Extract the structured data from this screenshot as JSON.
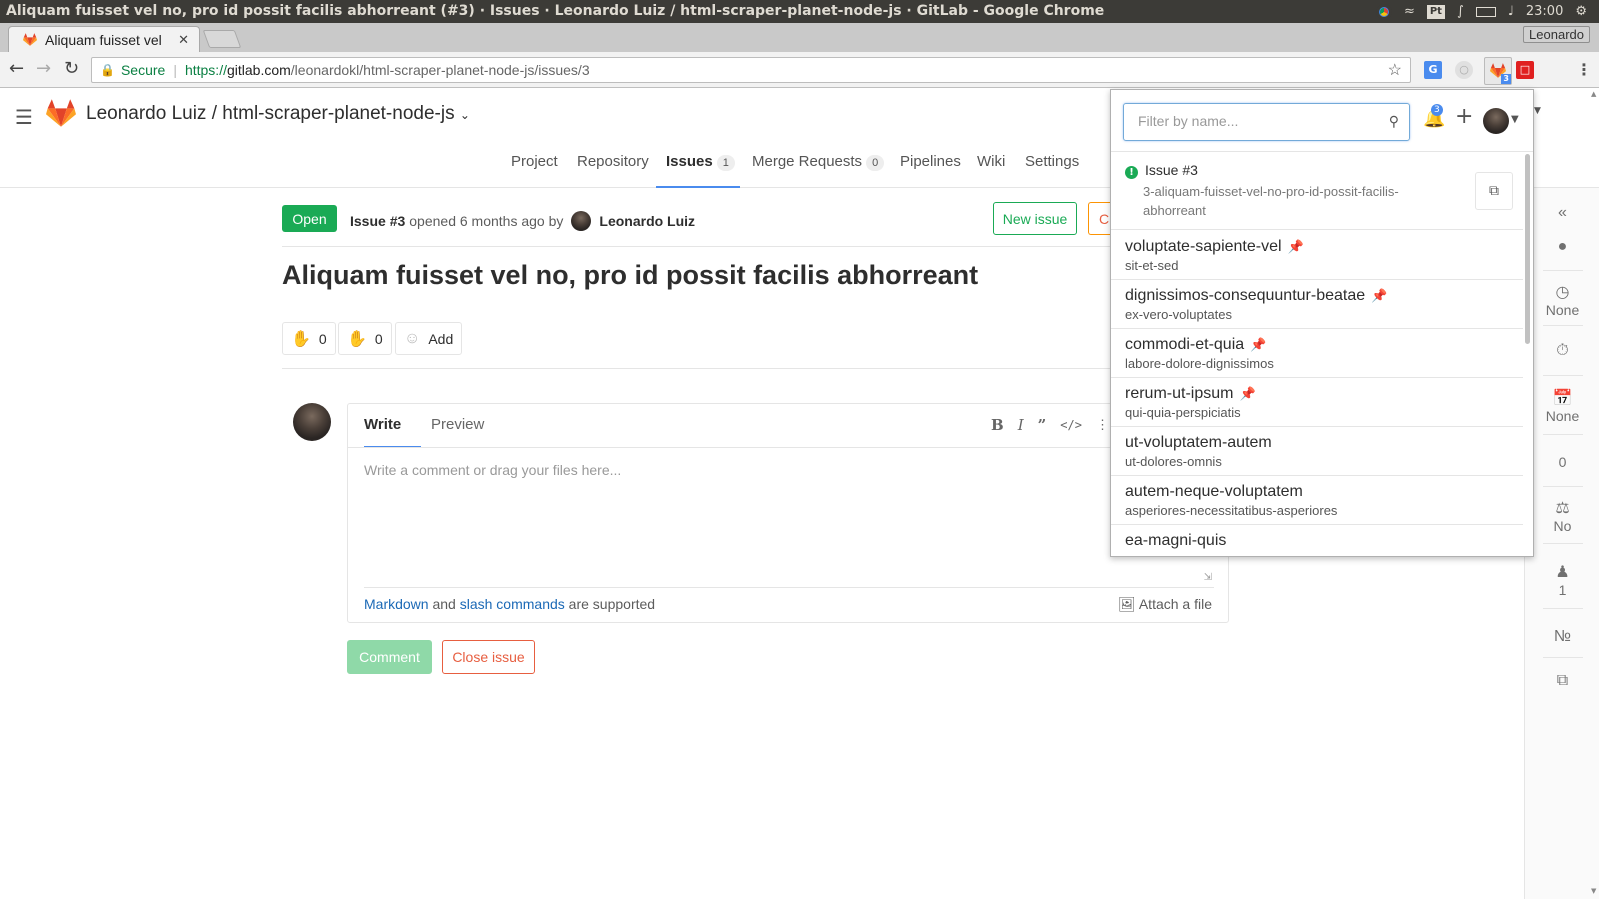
{
  "os": {
    "window_title": "Aliquam fuisset vel no, pro id possit facilis abhorreant (#3) · Issues · Leonardo Luiz / html-scraper-planet-node-js · GitLab - Google Chrome",
    "tray_pt": "Pt",
    "time": "23:00"
  },
  "browser": {
    "tab_title": "Aliquam fuisset vel",
    "profile": "Leonardo",
    "secure_label": "Secure",
    "url_scheme": "https://",
    "url_host": "gitlab.com",
    "url_path": "/leonardokl/html-scraper-planet-node-js/issues/3",
    "ext_badge": "3"
  },
  "header": {
    "project_title": "Leonardo Luiz / html-scraper-planet-node-js",
    "nav": [
      {
        "label": "Project",
        "count": ""
      },
      {
        "label": "Repository",
        "count": ""
      },
      {
        "label": "Issues",
        "count": "1"
      },
      {
        "label": "Merge Requests",
        "count": "0"
      },
      {
        "label": "Pipelines",
        "count": ""
      },
      {
        "label": "Wiki",
        "count": ""
      },
      {
        "label": "Settings",
        "count": ""
      }
    ],
    "active_nav": "Issues"
  },
  "issue": {
    "status": "Open",
    "number": "Issue #3",
    "opened_text": "opened 6 months ago by",
    "author": "Leonardo Luiz",
    "new_issue_label": "New issue",
    "close_partial": "C",
    "title": "Aliquam fuisset vel no, pro id possit facilis abhorreant",
    "thumbs_up": "0",
    "thumbs_down": "0",
    "add_award": "Add"
  },
  "editor": {
    "tab_write": "Write",
    "tab_preview": "Preview",
    "placeholder": "Write a comment or drag your files here...",
    "markdown_link": "Markdown",
    "and_text": "and",
    "slash_link": "slash commands",
    "supported_text": "are supported",
    "attach_label": "Attach a file",
    "comment_button": "Comment",
    "close_button": "Close issue"
  },
  "sidebar": {
    "due_value": "None",
    "milestone_value": "None",
    "time_value": "0",
    "lock_value": "No",
    "participants": "1"
  },
  "popup": {
    "filter_placeholder": "Filter by name...",
    "bell_count": "3",
    "issue_card": {
      "title": "Issue #3",
      "slug": "3-aliquam-fuisset-vel-no-pro-id-possit-facilis-abhorreant"
    },
    "projects": [
      {
        "name": "voluptate-sapiente-vel",
        "namespace": "sit-et-sed",
        "pinned": true
      },
      {
        "name": "dignissimos-consequuntur-beatae",
        "namespace": "ex-vero-voluptates",
        "pinned": true
      },
      {
        "name": "commodi-et-quia",
        "namespace": "labore-dolore-dignissimos",
        "pinned": true
      },
      {
        "name": "rerum-ut-ipsum",
        "namespace": "qui-quia-perspiciatis",
        "pinned": true
      },
      {
        "name": "ut-voluptatem-autem",
        "namespace": "ut-dolores-omnis",
        "pinned": false
      },
      {
        "name": "autem-neque-voluptatem",
        "namespace": "asperiores-necessitatibus-asperiores",
        "pinned": false
      },
      {
        "name": "ea-magni-quis",
        "namespace": "",
        "pinned": false
      }
    ]
  },
  "colors": {
    "accent": "#1aaa55",
    "link": "#1b69b6",
    "danger": "#e75e40",
    "active_tab": "#4a8bee"
  }
}
